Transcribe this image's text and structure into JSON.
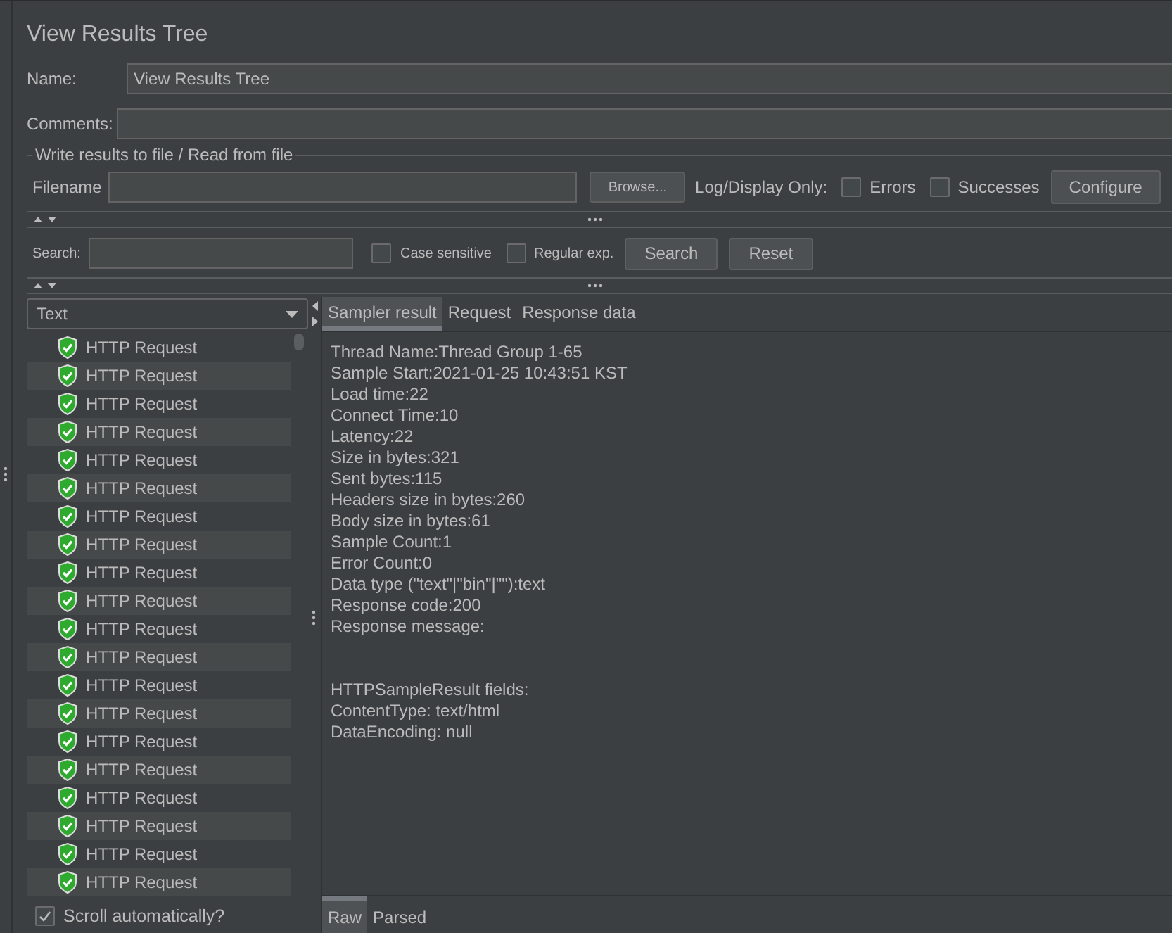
{
  "title": "View Results Tree",
  "name_field": {
    "label": "Name:",
    "value": "View Results Tree"
  },
  "comments_field": {
    "label": "Comments:"
  },
  "file_section": {
    "legend": "Write results to file / Read from file",
    "filename_label": "Filename",
    "browse_button": "Browse...",
    "log_display_label": "Log/Display Only:",
    "options": [
      {
        "label": "Errors",
        "checked": false
      },
      {
        "label": "Successes",
        "checked": false
      }
    ],
    "configure_button": "Configure"
  },
  "search_bar": {
    "label": "Search:",
    "options": [
      {
        "label": "Case sensitive",
        "checked": false
      },
      {
        "label": "Regular exp.",
        "checked": false
      }
    ],
    "search_button": "Search",
    "reset_button": "Reset"
  },
  "renderer_dropdown": {
    "value": "Text"
  },
  "results": [
    {
      "label": "HTTP Request",
      "kind": "success"
    },
    {
      "label": "HTTP Request",
      "kind": "success"
    },
    {
      "label": "HTTP Request",
      "kind": "success"
    },
    {
      "label": "HTTP Request",
      "kind": "success"
    },
    {
      "label": "HTTP Request",
      "kind": "success"
    },
    {
      "label": "HTTP Request",
      "kind": "success"
    },
    {
      "label": "HTTP Request",
      "kind": "success"
    },
    {
      "label": "HTTP Request",
      "kind": "success"
    },
    {
      "label": "HTTP Request",
      "kind": "success"
    },
    {
      "label": "HTTP Request",
      "kind": "success"
    },
    {
      "label": "HTTP Request",
      "kind": "success"
    },
    {
      "label": "HTTP Request",
      "kind": "success"
    },
    {
      "label": "HTTP Request",
      "kind": "success"
    },
    {
      "label": "HTTP Request",
      "kind": "success"
    },
    {
      "label": "HTTP Request",
      "kind": "success"
    },
    {
      "label": "HTTP Request",
      "kind": "success"
    },
    {
      "label": "HTTP Request",
      "kind": "success"
    },
    {
      "label": "HTTP Request",
      "kind": "success"
    },
    {
      "label": "HTTP Request",
      "kind": "success"
    },
    {
      "label": "HTTP Request",
      "kind": "success"
    }
  ],
  "scroll_automatically": {
    "label": "Scroll automatically?",
    "checked": true
  },
  "result_tabs": [
    {
      "label": "Sampler result",
      "selected": true
    },
    {
      "label": "Request",
      "selected": false
    },
    {
      "label": "Response data",
      "selected": false
    }
  ],
  "result_sections": [
    {
      "lines": [
        "Thread Name:Thread Group 1-65",
        "Sample Start:2021-01-25 10:43:51 KST",
        "Load time:22",
        "Connect Time:10",
        "Latency:22",
        "Size in bytes:321",
        "Sent bytes:115",
        "Headers size in bytes:260",
        "Body size in bytes:61",
        "Sample Count:1",
        "Error Count:0",
        "Data type (\"text\"|\"bin\"|\"\"):text",
        "Response code:200",
        "Response message:"
      ]
    },
    {
      "lines": [
        "HTTPSampleResult fields:",
        "ContentType: text/html",
        "DataEncoding: null"
      ]
    }
  ],
  "view_tabs": [
    {
      "label": "Raw",
      "selected": true
    },
    {
      "label": "Parsed",
      "selected": false
    }
  ]
}
